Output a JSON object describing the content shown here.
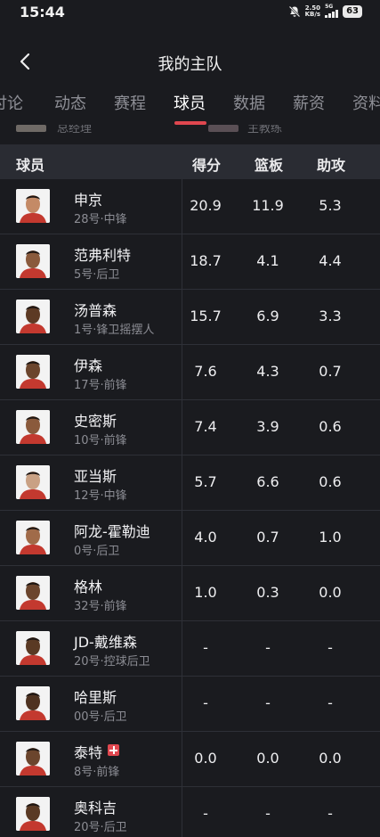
{
  "status": {
    "time": "15:44",
    "net_speed_value": "2.50",
    "net_speed_unit": "KB/s",
    "network": "5G",
    "battery": "63"
  },
  "nav": {
    "title": "我的主队"
  },
  "tabs": [
    {
      "label": "讨论",
      "active": false
    },
    {
      "label": "动态",
      "active": false
    },
    {
      "label": "赛程",
      "active": false
    },
    {
      "label": "球员",
      "active": true
    },
    {
      "label": "数据",
      "active": false
    },
    {
      "label": "薪资",
      "active": false
    },
    {
      "label": "资料",
      "active": false
    }
  ],
  "staff": {
    "gm_label": "总经理",
    "coach_label": "主教练"
  },
  "table": {
    "headers": {
      "player": "球员",
      "points": "得分",
      "rebounds": "篮板",
      "assists": "助攻"
    },
    "rows": [
      {
        "name": "申京",
        "info": "28号·中锋",
        "pts": "20.9",
        "reb": "11.9",
        "ast": "5.3",
        "injured": false
      },
      {
        "name": "范弗利特",
        "info": "5号·后卫",
        "pts": "18.7",
        "reb": "4.1",
        "ast": "4.4",
        "injured": false
      },
      {
        "name": "汤普森",
        "info": "1号·锋卫摇摆人",
        "pts": "15.7",
        "reb": "6.9",
        "ast": "3.3",
        "injured": false
      },
      {
        "name": "伊森",
        "info": "17号·前锋",
        "pts": "7.6",
        "reb": "4.3",
        "ast": "0.7",
        "injured": false
      },
      {
        "name": "史密斯",
        "info": "10号·前锋",
        "pts": "7.4",
        "reb": "3.9",
        "ast": "0.6",
        "injured": false
      },
      {
        "name": "亚当斯",
        "info": "12号·中锋",
        "pts": "5.7",
        "reb": "6.6",
        "ast": "0.6",
        "injured": false
      },
      {
        "name": "阿龙-霍勒迪",
        "info": "0号·后卫",
        "pts": "4.0",
        "reb": "0.7",
        "ast": "1.0",
        "injured": false
      },
      {
        "name": "格林",
        "info": "32号·前锋",
        "pts": "1.0",
        "reb": "0.3",
        "ast": "0.0",
        "injured": false
      },
      {
        "name": "JD-戴维森",
        "info": "20号·控球后卫",
        "pts": "-",
        "reb": "-",
        "ast": "-",
        "injured": false
      },
      {
        "name": "哈里斯",
        "info": "00号·后卫",
        "pts": "-",
        "reb": "-",
        "ast": "-",
        "injured": false
      },
      {
        "name": "泰特",
        "info": "8号·前锋",
        "pts": "0.0",
        "reb": "0.0",
        "ast": "0.0",
        "injured": true
      },
      {
        "name": "奥科吉",
        "info": "20号·后卫",
        "pts": "-",
        "reb": "-",
        "ast": "-",
        "injured": false
      }
    ]
  },
  "colors": {
    "accent": "#e0474f",
    "background": "#1a1b1f",
    "header_bg": "#2a2c33"
  }
}
